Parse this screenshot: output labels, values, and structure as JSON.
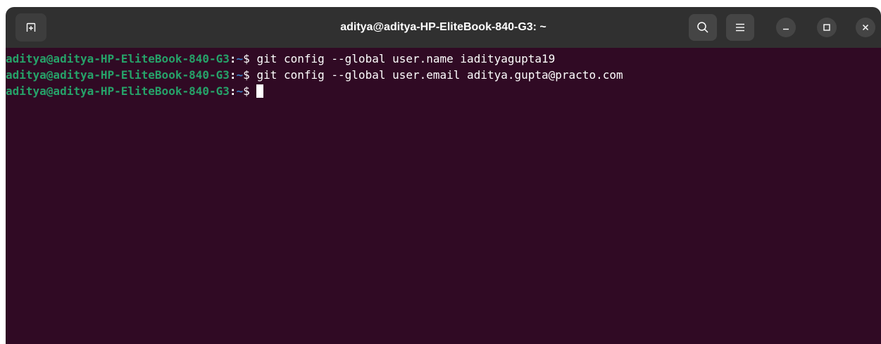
{
  "window": {
    "title": "aditya@aditya-HP-EliteBook-840-G3: ~"
  },
  "toolbar": {
    "new_tab_icon": "new-tab-icon",
    "search_icon": "search-icon",
    "menu_icon": "hamburger-menu-icon",
    "minimize_icon": "minimize-icon",
    "maximize_icon": "maximize-icon",
    "close_icon": "close-icon"
  },
  "terminal": {
    "background": "#300a24",
    "prompt_user_color": "#26a269",
    "lines": [
      {
        "user_host": "aditya@aditya-HP-EliteBook-840-G3",
        "sep": ":",
        "path": "~",
        "dollar": "$ ",
        "command": "git config --global user.name iadityagupta19"
      },
      {
        "user_host": "aditya@aditya-HP-EliteBook-840-G3",
        "sep": ":",
        "path": "~",
        "dollar": "$ ",
        "command": "git config --global user.email aditya.gupta@practo.com"
      },
      {
        "user_host": "aditya@aditya-HP-EliteBook-840-G3",
        "sep": ":",
        "path": "~",
        "dollar": "$ ",
        "command": ""
      }
    ]
  }
}
